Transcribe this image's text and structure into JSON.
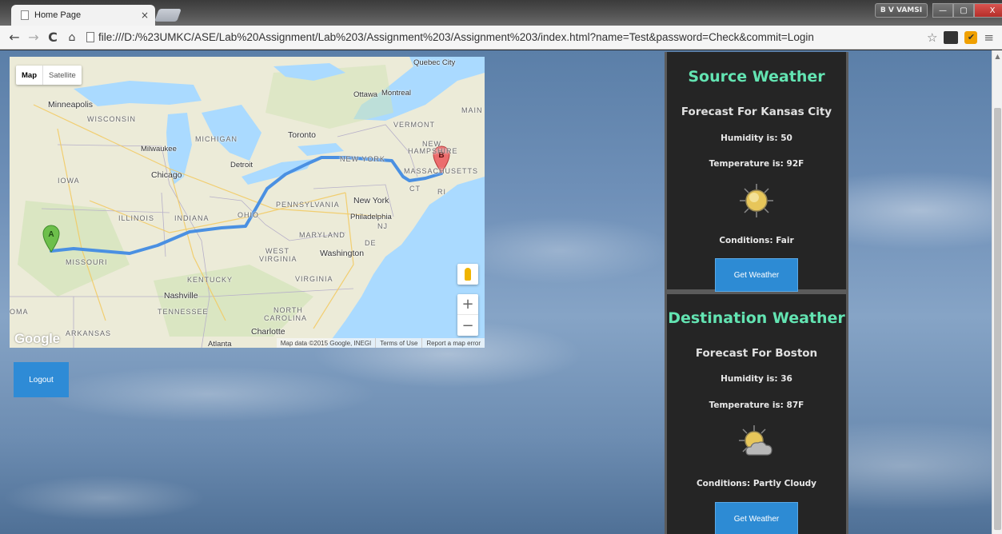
{
  "browser": {
    "tab_title": "Home Page",
    "tab_close": "×",
    "user_badge": "B V VAMSI",
    "url": "file:///D:/%23UMKC/ASE/Lab%20Assignment/Lab%203/Assignment%203/Assignment%203/index.html?name=Test&password=Check&commit=Login",
    "window_buttons": {
      "minimize": "—",
      "maximize": "▢",
      "close": "X"
    }
  },
  "map": {
    "type_controls": {
      "map": "Map",
      "satellite": "Satellite"
    },
    "zoom": {
      "in": "+",
      "out": "−"
    },
    "logo": "Google",
    "attribution": {
      "data": "Map data ©2015 Google, INEGI",
      "terms": "Terms of Use",
      "report": "Report a map error"
    },
    "markers": {
      "start": "A",
      "end": "B"
    },
    "labels": {
      "quebec_city": "Quebec City",
      "ottawa": "Ottawa",
      "montreal": "Montreal",
      "minneapolis": "Minneapolis",
      "wisconsin": "WISCONSIN",
      "michigan": "MICHIGAN",
      "toronto": "Toronto",
      "vermont": "VERMONT",
      "main": "MAIN",
      "milwaukee": "Milwaukee",
      "detroit": "Detroit",
      "new_hampshire_1": "NEW",
      "new_hampshire_2": "HAMPSHIRE",
      "new_york_state": "NEW YORK",
      "massachusetts": "MASSACHUSETTS",
      "iowa": "IOWA",
      "chicago": "Chicago",
      "ct": "CT",
      "ri": "RI",
      "new_york_city": "New York",
      "pennsylvania": "PENNSYLVANIA",
      "illinois": "ILLINOIS",
      "indiana": "INDIANA",
      "ohio": "OHIO",
      "philadelphia": "Philadelphia",
      "nj": "NJ",
      "maryland": "MARYLAND",
      "de": "DE",
      "west": "WEST",
      "virginia_w": "VIRGINIA",
      "washington": "Washington",
      "missouri": "MISSOURI",
      "kentucky": "KENTUCKY",
      "virginia": "VIRGINIA",
      "nashville": "Nashville",
      "oma": "OMA",
      "tennessee": "TENNESSEE",
      "north": "NORTH",
      "carolina": "CAROLINA",
      "arkansas": "ARKANSAS",
      "charlotte": "Charlotte",
      "atlanta": "Atlanta"
    }
  },
  "logout_label": "Logout",
  "source": {
    "heading": "Source Weather",
    "forecast": "Forecast For Kansas City",
    "humidity": "Humidity is: 50",
    "temperature": "Temperature is: 92F",
    "conditions": "Conditions: Fair",
    "icon": "sun-icon",
    "button": "Get Weather"
  },
  "destination": {
    "heading": "Destination Weather",
    "forecast": "Forecast For Boston",
    "humidity": "Humidity is: 36",
    "temperature": "Temperature is: 87F",
    "conditions": "Conditions: Partly Cloudy",
    "icon": "partly-cloudy-icon",
    "button": "Get Weather"
  },
  "colors": {
    "heading": "#63e4b2",
    "button": "#2d8bd4",
    "panel_bg": "#252525",
    "route": "#4a90e2"
  }
}
